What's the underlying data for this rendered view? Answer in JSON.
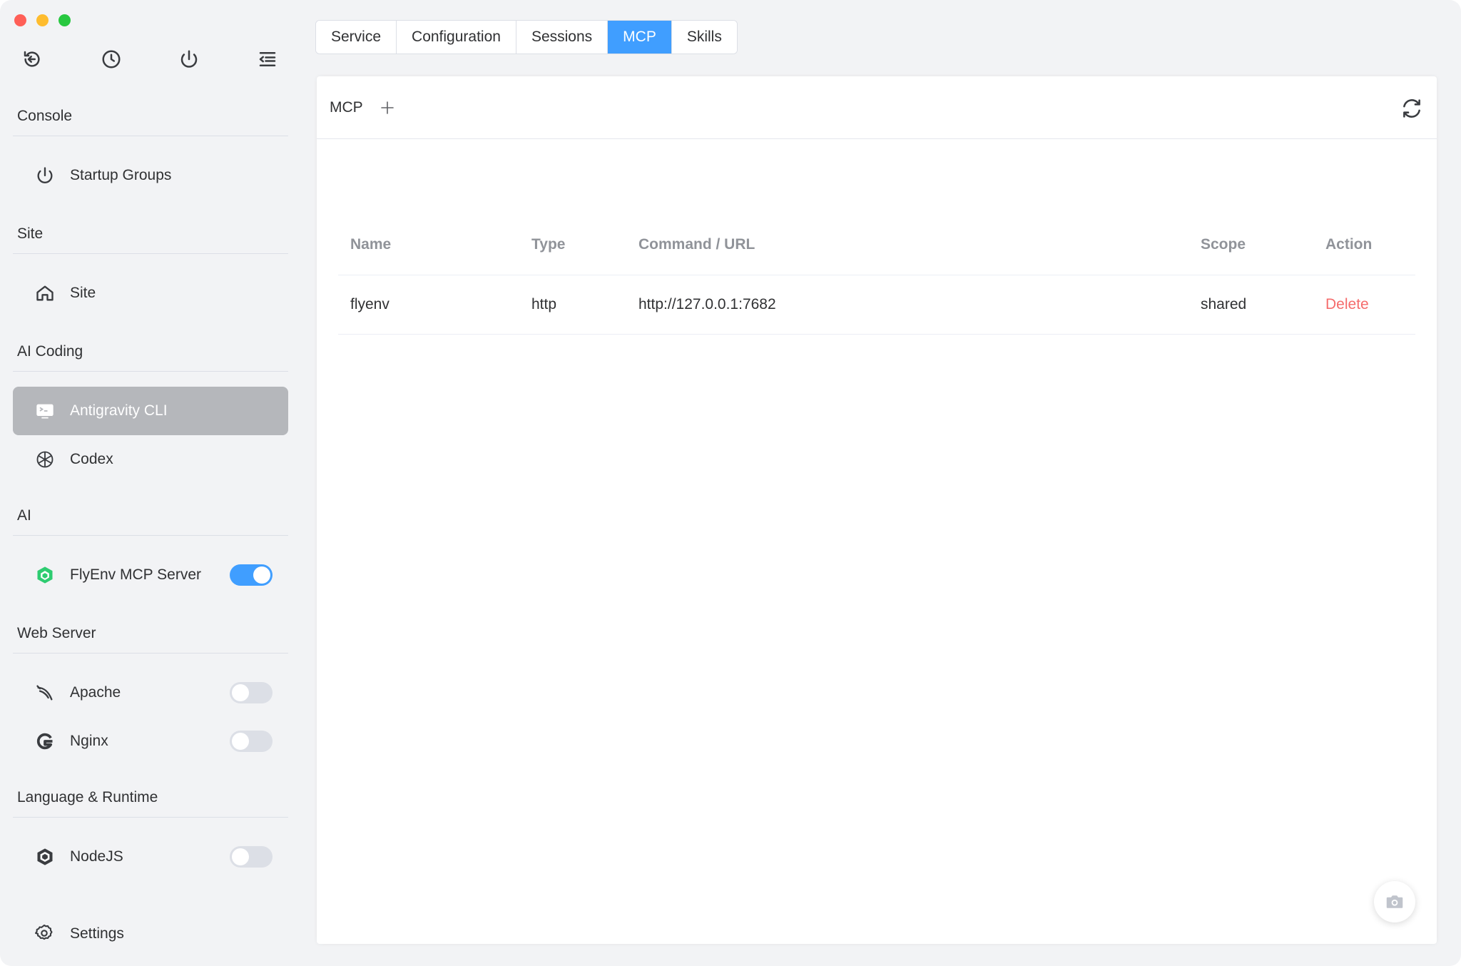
{
  "window": {
    "traffic_lights": [
      "close",
      "minimize",
      "maximize"
    ],
    "toolbar_icons": [
      "back-icon",
      "history-icon",
      "power-icon",
      "menu-collapse-icon"
    ]
  },
  "sidebar": {
    "sections": [
      {
        "title": "Console",
        "items": [
          {
            "label": "Startup Groups",
            "icon": "power-icon"
          }
        ]
      },
      {
        "title": "Site",
        "items": [
          {
            "label": "Site",
            "icon": "home-icon"
          }
        ]
      },
      {
        "title": "AI Coding",
        "items": [
          {
            "label": "Antigravity CLI",
            "icon": "terminal-icon",
            "active": true
          },
          {
            "label": "Codex",
            "icon": "openai-icon"
          }
        ]
      },
      {
        "title": "AI",
        "items": [
          {
            "label": "FlyEnv MCP Server",
            "icon": "cube-icon",
            "toggle": true
          }
        ]
      },
      {
        "title": "Web Server",
        "items": [
          {
            "label": "Apache",
            "icon": "feather-icon",
            "toggle": false
          },
          {
            "label": "Nginx",
            "icon": "nginx-icon",
            "toggle": false
          }
        ]
      },
      {
        "title": "Language & Runtime",
        "items": [
          {
            "label": "NodeJS",
            "icon": "nodejs-icon",
            "toggle": false
          }
        ]
      }
    ],
    "settings_label": "Settings"
  },
  "tabs": [
    {
      "label": "Service",
      "active": false
    },
    {
      "label": "Configuration",
      "active": false
    },
    {
      "label": "Sessions",
      "active": false
    },
    {
      "label": "MCP",
      "active": true
    },
    {
      "label": "Skills",
      "active": false
    }
  ],
  "panel": {
    "title": "MCP",
    "table": {
      "headers": {
        "name": "Name",
        "type": "Type",
        "cmd": "Command / URL",
        "scope": "Scope",
        "action": "Action"
      },
      "rows": [
        {
          "name": "flyenv",
          "type": "http",
          "cmd": "http://127.0.0.1:7682",
          "scope": "shared",
          "action": "Delete"
        }
      ]
    }
  },
  "colors": {
    "accent": "#409eff",
    "danger": "#f56c6c",
    "sidebar_bg": "#f2f3f5",
    "active_item_bg": "#b5b7bb"
  }
}
